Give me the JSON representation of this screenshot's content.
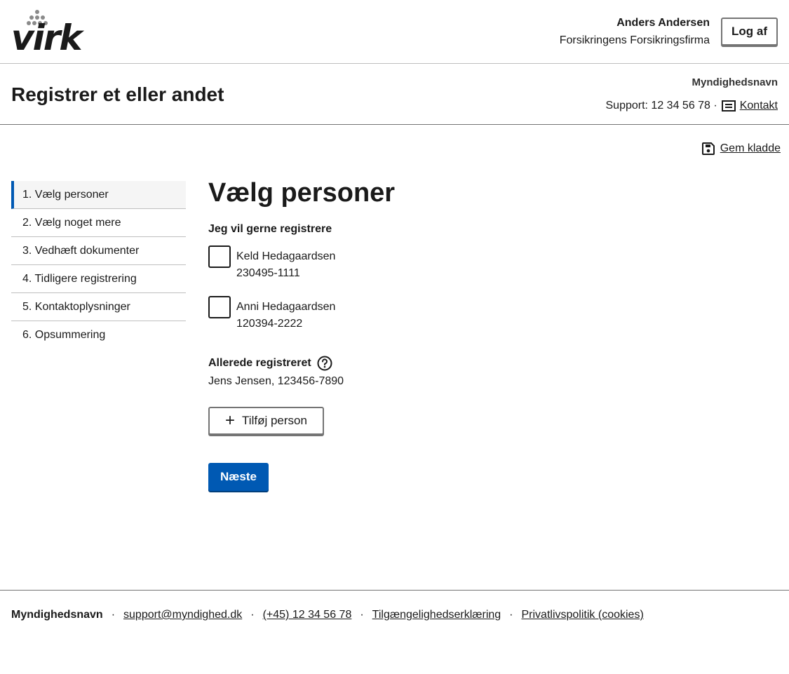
{
  "header": {
    "logo_text": "virk",
    "user_name": "Anders Andersen",
    "user_company": "Forsikringens Forsikringsfirma",
    "logout_label": "Log af"
  },
  "solution": {
    "title": "Registrer et eller andet",
    "authority": "Myndighedsnavn",
    "support_text": "Support: 12 34 56 78 ·",
    "contact_label": "Kontakt"
  },
  "draft": {
    "save_label": "Gem kladde"
  },
  "menu": {
    "items": [
      {
        "label": "1. Vælg personer",
        "current": true
      },
      {
        "label": "2. Vælg noget mere"
      },
      {
        "label": "3. Vedhæft dokumenter"
      },
      {
        "label": "4. Tidligere registrering"
      },
      {
        "label": "5. Kontaktoplysninger"
      },
      {
        "label": "6. Opsummering"
      }
    ]
  },
  "main": {
    "heading": "Vælg personer",
    "legend": "Jeg vil gerne registrere",
    "persons": [
      {
        "name": "Keld Hedagaardsen",
        "cpr": "230495-1111"
      },
      {
        "name": "Anni Hedagaardsen",
        "cpr": "120394-2222"
      }
    ],
    "already_title": "Allerede registreret",
    "already_value": "Jens Jensen, 123456-7890",
    "add_label": "Tilføj person",
    "next_label": "Næste"
  },
  "footer": {
    "name": "Myndighedsnavn",
    "email": "support@myndighed.dk",
    "phone": "(+45) 12 34 56 78",
    "accessibility": "Tilgængelighedserklæring",
    "privacy": "Privatlivspolitik (cookies)"
  },
  "colors": {
    "primary": "#0059b3",
    "border": "#747474",
    "current_bg": "#f5f5f5"
  }
}
